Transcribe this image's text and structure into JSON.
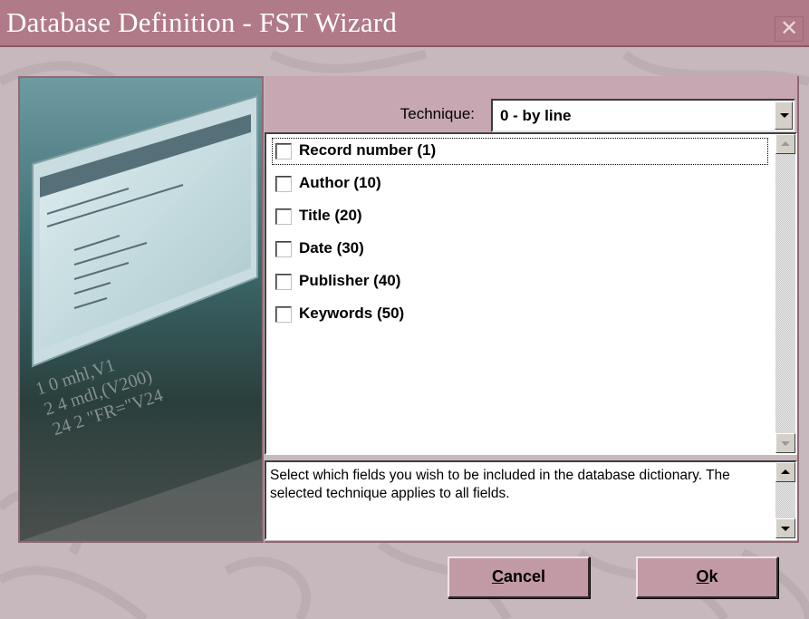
{
  "window": {
    "title": "Database Definition - FST Wizard",
    "close_glyph": "✕"
  },
  "illustration": {
    "name": "wizard-illustration",
    "reflection_lines": [
      "1 0 mhl,V1",
      "2 4 mdl,(V200)",
      "24 2 \"FR=\"V24"
    ]
  },
  "technique": {
    "label": "Technique:",
    "value": "0 - by line"
  },
  "fields": [
    {
      "label": "Record number (1)",
      "checked": false
    },
    {
      "label": "Author (10)",
      "checked": false
    },
    {
      "label": "Title (20)",
      "checked": false
    },
    {
      "label": "Date (30)",
      "checked": false
    },
    {
      "label": "Publisher (40)",
      "checked": false
    },
    {
      "label": "Keywords (50)",
      "checked": false
    }
  ],
  "description": "Select which fields you wish to be included in the database dictionary. The selected technique applies to all fields.",
  "buttons": {
    "cancel": {
      "mnemonic": "C",
      "rest": "ancel"
    },
    "ok": {
      "mnemonic": "O",
      "rest": "k"
    }
  },
  "colors": {
    "titlebar": "#b07a88",
    "window_bg": "#c6b8bc",
    "button_face": "#c19aa6",
    "header_band": "#c7a7b1"
  }
}
